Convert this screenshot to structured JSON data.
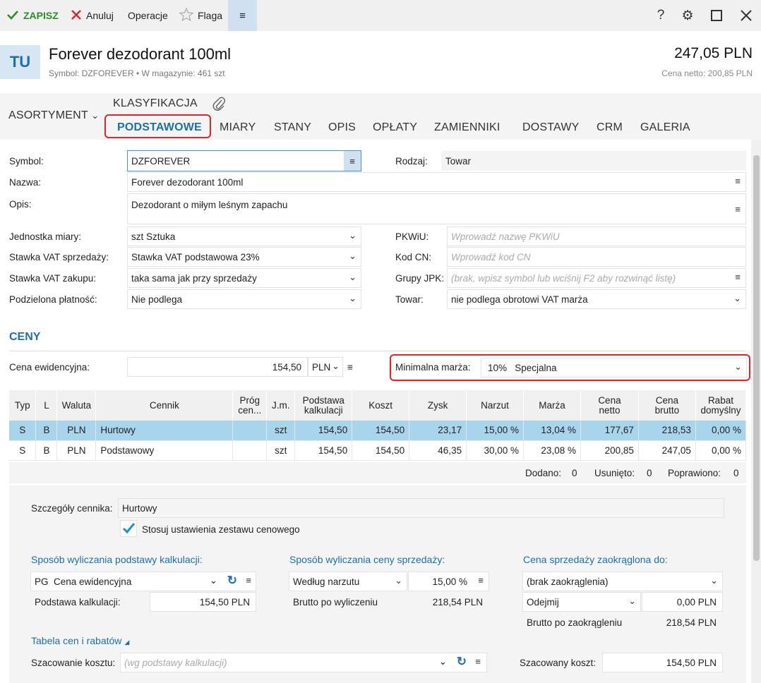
{
  "toolbar": {
    "save": "ZAPISZ",
    "cancel": "Anuluj",
    "operations": "Operacje",
    "flag": "Flaga"
  },
  "header": {
    "badge": "TU",
    "title": "Forever dezodorant 100ml",
    "subtitle": "Symbol: DZFOREVER  •  W magazynie: 461 szt",
    "price": "247,05 PLN",
    "netto": "Cena netto: 200,85 PLN"
  },
  "tabs": {
    "klasyfikacja": "KLASYFIKACJA",
    "asortyment": "ASORTYMENT",
    "items": [
      "PODSTAWOWE",
      "MIARY",
      "STANY",
      "OPIS",
      "OPŁATY",
      "ZAMIENNIKI",
      "DOSTAWY",
      "CRM",
      "GALERIA"
    ]
  },
  "form": {
    "symbol_label": "Symbol:",
    "symbol_value": "DZFOREVER",
    "rodzaj_label": "Rodzaj:",
    "rodzaj_value": "Towar",
    "nazwa_label": "Nazwa:",
    "nazwa_value": "Forever dezodorant 100ml",
    "opis_label": "Opis:",
    "opis_value": "Dezodorant o miłym leśnym zapachu",
    "jm_label": "Jednostka miary:",
    "jm_value": "szt  Sztuka",
    "vat_sprz_label": "Stawka VAT sprzedaży:",
    "vat_sprz_value": "Stawka VAT podstawowa 23%",
    "vat_zak_label": "Stawka VAT zakupu:",
    "vat_zak_value": "taka sama jak przy sprzedaży",
    "podz_label": "Podzielona płatność:",
    "podz_value": "Nie podlega",
    "pkwiu_label": "PKWiU:",
    "pkwiu_placeholder": "Wprowadź nazwę PKWiU",
    "kodcn_label": "Kod CN:",
    "kodcn_placeholder": "Wprowadź kod CN",
    "jpk_label": "Grupy JPK:",
    "jpk_placeholder": "(brak, wpisz symbol lub wciśnij F2 aby rozwinąć listę)",
    "towar_label": "Towar:",
    "towar_value": "nie podlega obrotowi VAT marża"
  },
  "ceny": {
    "title": "CENY",
    "ewid_label": "Cena ewidencyjna:",
    "ewid_value": "154,50",
    "ewid_currency": "PLN",
    "minmarza_label": "Minimalna marża:",
    "minmarza_value": "10%   Specjalna"
  },
  "grid": {
    "headers": [
      "Typ",
      "L",
      "Waluta",
      "Cennik",
      "Próg cen...",
      "J.m.",
      "Podstawa kalkulacji",
      "Koszt",
      "Zysk",
      "Narzut",
      "Marża",
      "Cena netto",
      "Cena brutto",
      "Rabat domyślny"
    ],
    "rows": [
      [
        "S",
        "B",
        "PLN",
        "Hurtowy",
        "",
        "szt",
        "154,50",
        "154,50",
        "23,17",
        "15,00 %",
        "13,04 %",
        "177,67",
        "218,53",
        "0,00 %"
      ],
      [
        "S",
        "B",
        "PLN",
        "Podstawowy",
        "",
        "szt",
        "154,50",
        "154,50",
        "46,35",
        "30,00 %",
        "23,08 %",
        "200,85",
        "247,05",
        "0,00 %"
      ]
    ],
    "summary": {
      "dodano_label": "Dodano:",
      "dodano": "0",
      "usunieto_label": "Usunięto:",
      "usunieto": "0",
      "poprawiono_label": "Poprawiono:",
      "poprawiono": "0"
    }
  },
  "details": {
    "szczegoly_label": "Szczegóły cennika:",
    "szczegoly_value": "Hurtowy",
    "stosuj": "Stosuj ustawienia zestawu cenowego",
    "sposob_podst_title": "Sposób wyliczania podstawy kalkulacji:",
    "sposob_podst_value": "PG  Cena ewidencyjna",
    "podstawa_label": "Podstawa kalkulacji:",
    "podstawa_value": "154,50 PLN",
    "sposob_ceny_title": "Sposób wyliczania ceny sprzedaży:",
    "sposob_ceny_value": "Według narzutu",
    "sposob_ceny_pct": "15,00 %",
    "brutto_wyl_label": "Brutto po wyliczeniu",
    "brutto_wyl_value": "218,54 PLN",
    "zaokr_title": "Cena sprzedaży zaokrąglona do:",
    "zaokr_value": "(brak zaokrąglenia)",
    "odejmij_value": "Odejmij",
    "odejmij_amount": "0,00 PLN",
    "brutto_zaokr_label": "Brutto po zaokrągleniu",
    "brutto_zaokr_value": "218,54 PLN",
    "tabela_link": "Tabela cen i rabatów",
    "szac_label": "Szacowanie kosztu:",
    "szac_placeholder": "(wg podstawy kalkulacji)",
    "szac_koszt_label": "Szacowany koszt:",
    "szac_koszt_value": "154,50 PLN"
  }
}
